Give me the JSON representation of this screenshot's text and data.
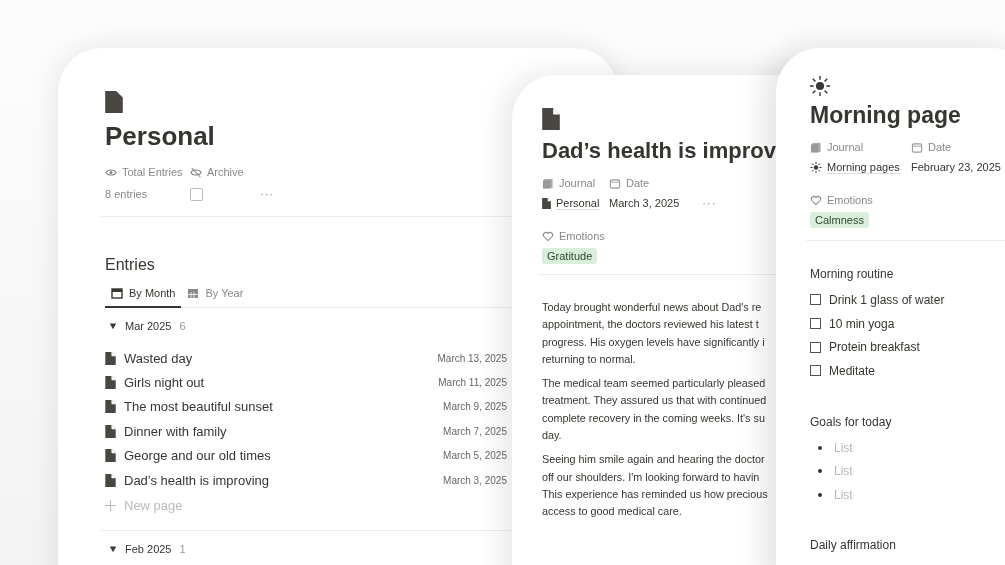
{
  "personal": {
    "title": "Personal",
    "properties": [
      {
        "label": "Total Entries"
      },
      {
        "label": "Archive"
      }
    ],
    "entries_count": "8 entries",
    "archived": false,
    "more": "···",
    "section_title": "Entries",
    "tabs": [
      {
        "label": "By Month",
        "selected": true
      },
      {
        "label": "By Year",
        "selected": false
      }
    ],
    "groups": [
      {
        "label": "Mar 2025",
        "count": "6",
        "expanded": true,
        "entries": [
          {
            "title": "Wasted day",
            "date": "March 13, 2025"
          },
          {
            "title": "Girls night out",
            "date": "March 11, 2025"
          },
          {
            "title": "The most beautiful sunset",
            "date": "March 9, 2025"
          },
          {
            "title": "Dinner with family",
            "date": "March 7, 2025"
          },
          {
            "title": "George and our old times",
            "date": "March 5, 2025"
          },
          {
            "title": "Dad’s health is improving",
            "date": "March 3, 2025"
          }
        ],
        "new_page": "New page"
      },
      {
        "label": "Feb 2025",
        "count": "1",
        "expanded": true
      }
    ]
  },
  "entry": {
    "title": "Dad’s health is improv",
    "properties": [
      {
        "label": "Journal"
      },
      {
        "label": "Date"
      }
    ],
    "journal": "Personal",
    "date": "March 3, 2025",
    "more": "···",
    "emotions_label": "Emotions",
    "emotions": [
      "Gratitude"
    ],
    "paragraphs": [
      [
        "Today brought wonderful news about Dad's re",
        "appointment, the doctors reviewed his latest t",
        "progress. His oxygen levels have significantly i",
        "returning to normal."
      ],
      [
        "The medical team seemed particularly pleased",
        "treatment. They assured us that with continued",
        "complete recovery in the coming weeks. It's su",
        "day."
      ],
      [
        "Seeing him smile again and hearing the doctor",
        "off our shoulders. I'm looking forward to havin",
        "This experience has reminded us how precious",
        "access to good medical care."
      ]
    ]
  },
  "morning": {
    "title": "Morning page",
    "properties": [
      {
        "label": "Journal"
      },
      {
        "label": "Date"
      }
    ],
    "journal": "Morning pages",
    "date": "February 23, 2025",
    "emotions_label": "Emotions",
    "emotions": [
      "Calmness"
    ],
    "routine_title": "Morning routine",
    "todos": [
      {
        "label": "Drink 1 glass of water",
        "checked": false
      },
      {
        "label": "10 min yoga",
        "checked": false
      },
      {
        "label": "Protein breakfast",
        "checked": false
      },
      {
        "label": "Meditate",
        "checked": false
      }
    ],
    "goals_title": "Goals for today",
    "goals": [
      "List",
      "List",
      "List"
    ],
    "affirmation_title": "Daily affirmation"
  }
}
